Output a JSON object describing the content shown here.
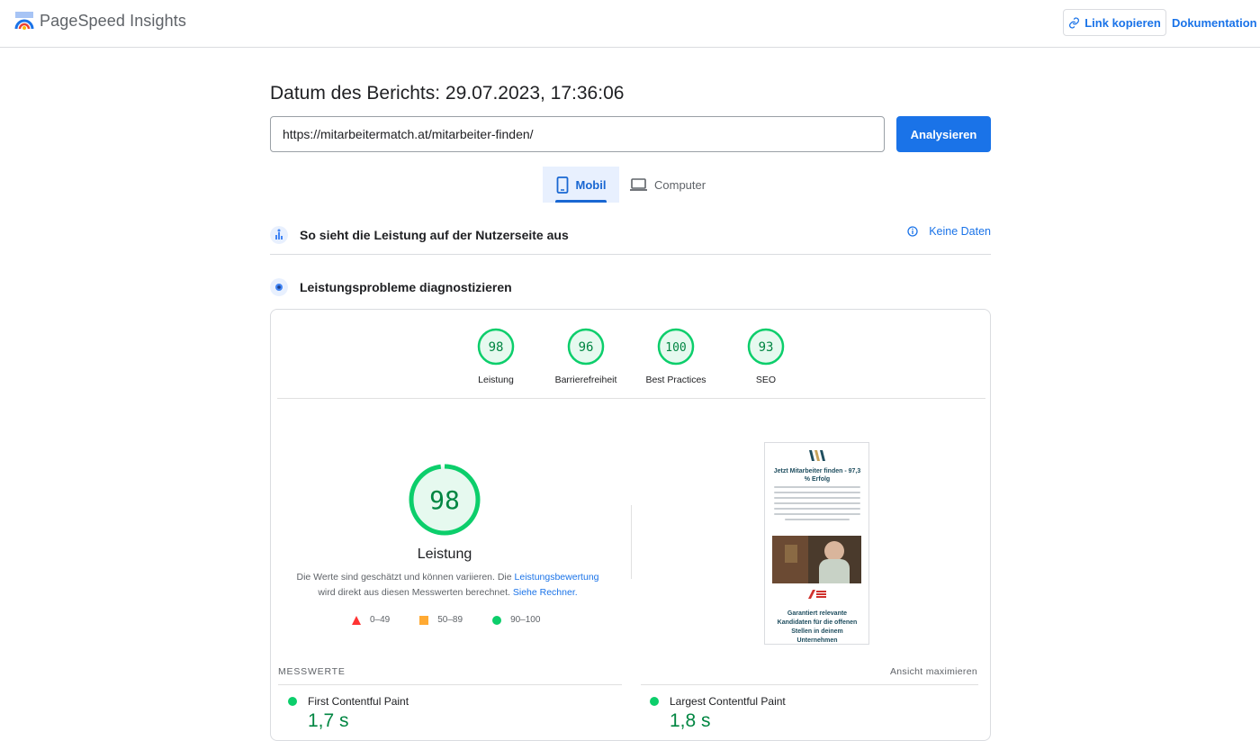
{
  "header": {
    "app_name": "PageSpeed Insights",
    "copy_link_label": "Link kopieren",
    "docs_label": "Dokumentation"
  },
  "report": {
    "date_label": "Datum des Berichts: 29.07.2023, 17:36:06",
    "url_value": "https://mitarbeitermatch.at/mitarbeiter-finden/",
    "analyze_label": "Analysieren"
  },
  "tabs": [
    {
      "label": "Mobil",
      "selected": true
    },
    {
      "label": "Computer",
      "selected": false
    }
  ],
  "field_data": {
    "title": "So sieht die Leistung auf der Nutzerseite aus",
    "no_data_label": "Keine Daten"
  },
  "diagnostics": {
    "title": "Leistungsprobleme diagnostizieren"
  },
  "scores": [
    {
      "value": "98",
      "label": "Leistung"
    },
    {
      "value": "96",
      "label": "Barrierefreiheit"
    },
    {
      "value": "100",
      "label": "Best Practices"
    },
    {
      "value": "93",
      "label": "SEO"
    }
  ],
  "performance": {
    "score": "98",
    "score_fraction": 0.98,
    "title": "Leistung",
    "desc_part1": "Die Werte sind geschätzt und können variieren. Die ",
    "desc_link1": "Leistungsbewertung",
    "desc_part2": " wird direkt aus diesen Messwerten berechnet. ",
    "desc_link2": "Siehe Rechner."
  },
  "legend": [
    {
      "range": "0–49",
      "color": "#ff3333"
    },
    {
      "range": "50–89",
      "color": "#ffaa33"
    },
    {
      "range": "90–100",
      "color": "#0cce6b"
    }
  ],
  "preview": {
    "heading": "Jetzt Mitarbeiter finden - 97,3 % Erfolg",
    "cta": "Garantiert relevante Kandidaten für die offenen Stellen in deinem Unternehmen"
  },
  "metrics": {
    "section_label": "MESSWERTE",
    "expand_label": "Ansicht maximieren",
    "items": [
      {
        "name": "First Contentful Paint",
        "value": "1,7 s"
      },
      {
        "name": "Largest Contentful Paint",
        "value": "1,8 s"
      }
    ]
  },
  "colors": {
    "accent": "#1a73e8",
    "pass": "#0cce6b",
    "pass_text": "#018642",
    "pass_bg": "#e6f9ef"
  }
}
